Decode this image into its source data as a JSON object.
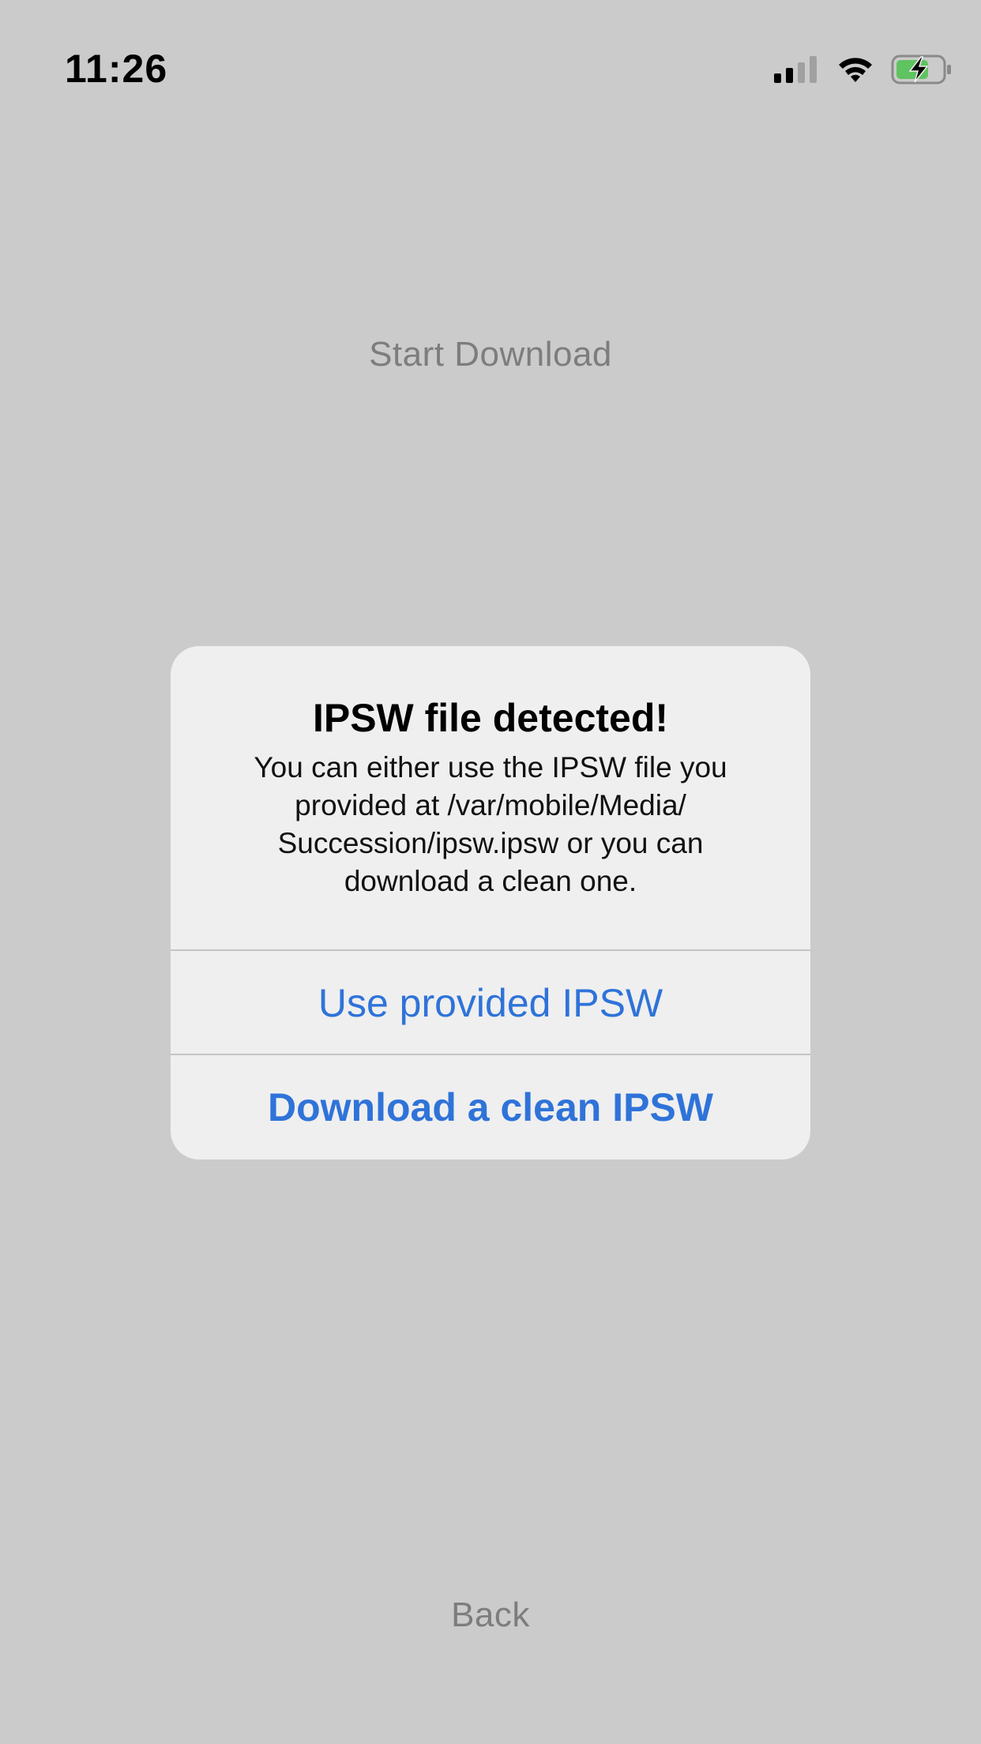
{
  "status_bar": {
    "time": "11:26",
    "icons": [
      "cellular-signal-icon",
      "wifi-icon",
      "battery-charging-icon"
    ]
  },
  "background": {
    "start_download_label": "Start Download",
    "back_label": "Back"
  },
  "alert": {
    "title": "IPSW file detected!",
    "message": "You can either use the IPSW file you provided at /var/mobile/Media/ Succession/ipsw.ipsw or you can download a clean one.",
    "actions": [
      {
        "label": "Use provided IPSW"
      },
      {
        "label": "Download a clean IPSW"
      }
    ]
  },
  "colors": {
    "background": "#cbcbcb",
    "alert_background": "#efefef",
    "accent": "#2f73d9",
    "battery_fill": "#5fc35f"
  }
}
